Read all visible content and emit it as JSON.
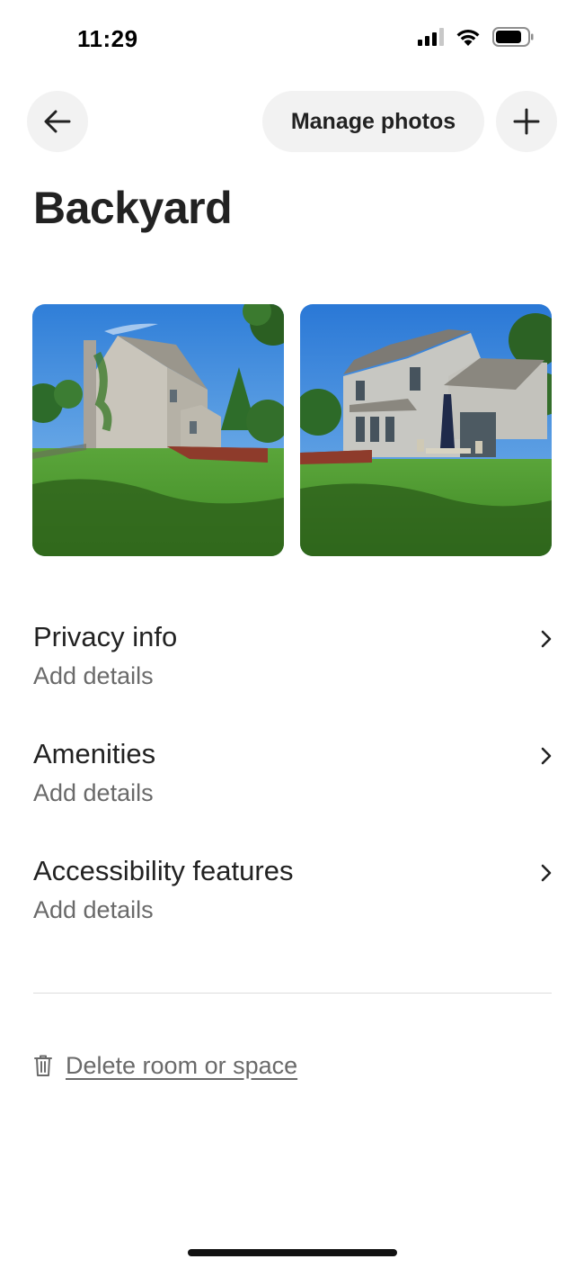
{
  "status_bar": {
    "time": "11:29"
  },
  "top_bar": {
    "back_icon": "arrow-left-icon",
    "manage_photos_label": "Manage photos",
    "add_icon": "plus-icon"
  },
  "page": {
    "title": "Backyard"
  },
  "photos": [
    {
      "subject": "backyard-photo-side-view"
    },
    {
      "subject": "backyard-photo-rear-view"
    }
  ],
  "details": [
    {
      "title": "Privacy info",
      "subtitle": "Add details"
    },
    {
      "title": "Amenities",
      "subtitle": "Add details"
    },
    {
      "title": "Accessibility features",
      "subtitle": "Add details"
    }
  ],
  "delete": {
    "icon": "trash-icon",
    "label": "Delete room or space"
  },
  "colors": {
    "text_primary": "#222222",
    "text_secondary": "#6a6a6a",
    "button_bg": "#f2f2f2",
    "divider": "#dddddd"
  }
}
